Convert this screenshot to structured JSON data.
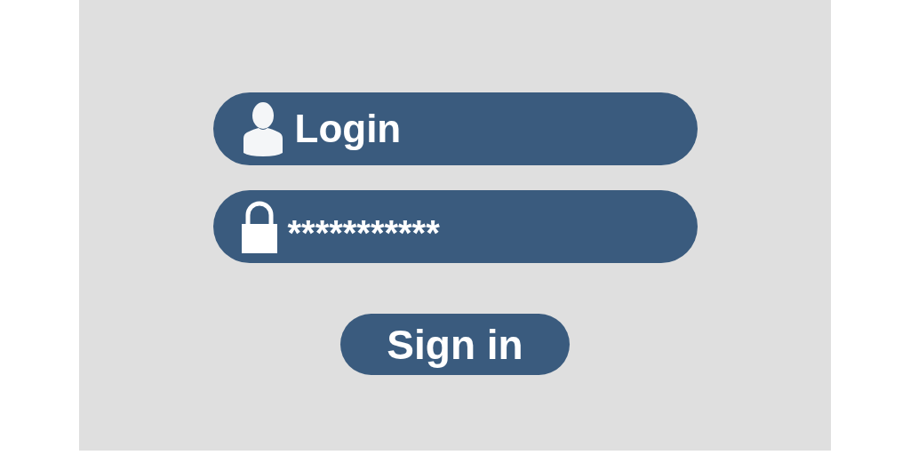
{
  "fields": [
    {
      "kind": "username",
      "value": "Login"
    },
    {
      "kind": "password",
      "value": "***********"
    }
  ],
  "button": {
    "label": "Sign in"
  }
}
